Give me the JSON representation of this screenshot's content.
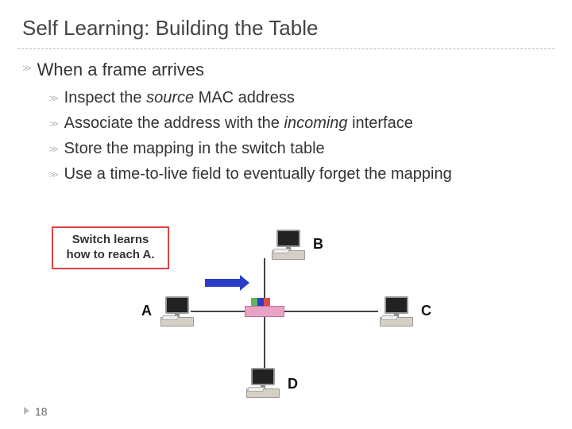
{
  "slide": {
    "title": "Self Learning: Building the Table",
    "number": "18"
  },
  "bullets": {
    "main": "When a frame arrives",
    "sub": [
      {
        "pre": "Inspect the ",
        "em": "source",
        "post": " MAC address"
      },
      {
        "pre": "Associate the address with the ",
        "em": "incoming",
        "post": " interface"
      },
      {
        "pre": "Store the mapping in the switch table",
        "em": "",
        "post": ""
      },
      {
        "pre": "Use a time-to-live field to eventually forget the mapping",
        "em": "",
        "post": ""
      }
    ]
  },
  "callout": "Switch learns how to reach A.",
  "nodes": {
    "A": "A",
    "B": "B",
    "C": "C",
    "D": "D"
  },
  "glyph": ">>"
}
